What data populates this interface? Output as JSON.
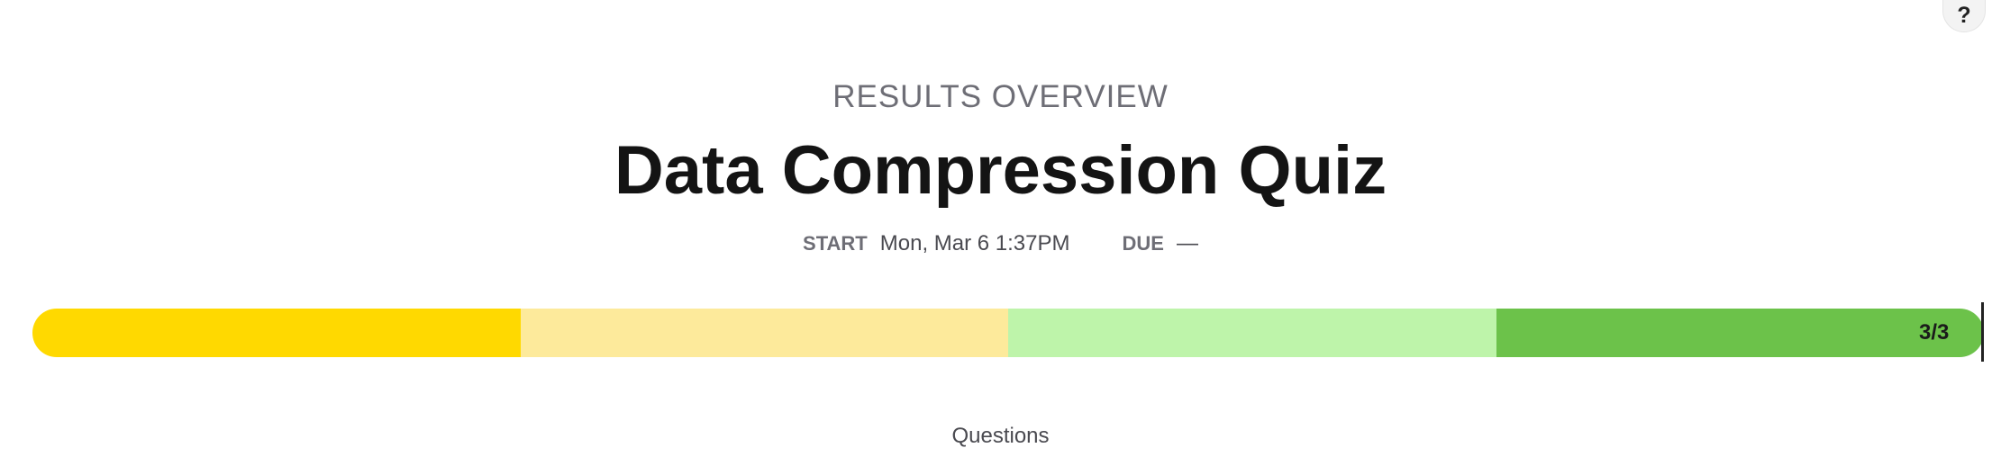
{
  "help": {
    "label": "?"
  },
  "header": {
    "subtitle": "RESULTS OVERVIEW",
    "title": "Data Compression Quiz"
  },
  "meta": {
    "start_key": "START",
    "start_value": "Mon, Mar 6 1:37PM",
    "due_key": "DUE",
    "due_value": "—"
  },
  "progress": {
    "label": "3/3",
    "completed": 3,
    "total": 3,
    "segments": [
      {
        "name": "segment-1",
        "color": "#FFD900",
        "fraction": 0.25
      },
      {
        "name": "segment-2",
        "color": "#FDEA9B",
        "fraction": 0.25
      },
      {
        "name": "segment-3",
        "color": "#BEF4AA",
        "fraction": 0.25
      },
      {
        "name": "segment-4",
        "color": "#6CC24A",
        "fraction": 0.25
      }
    ]
  },
  "questions": {
    "label": "Questions"
  }
}
